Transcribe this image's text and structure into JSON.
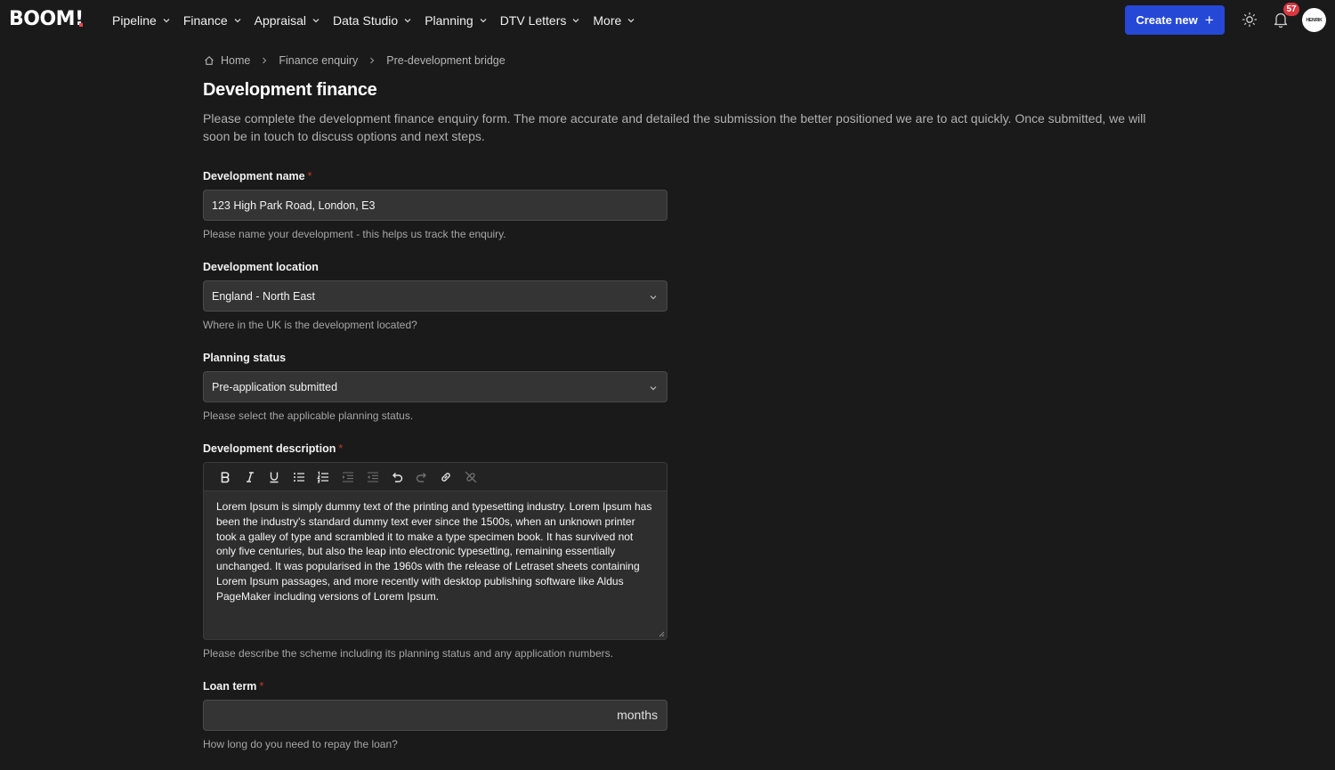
{
  "app": {
    "logo_text": "BOOM",
    "logo_mark": "!"
  },
  "nav": {
    "items": [
      {
        "label": "Pipeline"
      },
      {
        "label": "Finance"
      },
      {
        "label": "Appraisal"
      },
      {
        "label": "Data Studio"
      },
      {
        "label": "Planning"
      },
      {
        "label": "DTV Letters"
      },
      {
        "label": "More"
      }
    ],
    "create_label": "Create new",
    "create_icon": "plus-icon",
    "notification_count": "57",
    "avatar_text": "HENRIK"
  },
  "breadcrumb": {
    "items": [
      "Home",
      "Finance enquiry",
      "Pre-development bridge"
    ]
  },
  "page": {
    "title": "Development finance",
    "intro": "Please complete the development finance enquiry form. The more accurate and detailed the submission the better positioned we are to act quickly. Once submitted, we will soon be in touch to discuss options and next steps."
  },
  "form": {
    "dev_name": {
      "label": "Development name",
      "required_mark": "*",
      "value": "123 High Park Road, London, E3",
      "help": "Please name your development - this helps us track the enquiry."
    },
    "dev_location": {
      "label": "Development location",
      "value": "England - North East",
      "help": "Where in the UK is the development located?"
    },
    "planning_status": {
      "label": "Planning status",
      "value": "Pre-application submitted",
      "help": "Please select the applicable planning status."
    },
    "dev_description": {
      "label": "Development description",
      "required_mark": "*",
      "value": "Lorem Ipsum is simply dummy text of the printing and typesetting industry. Lorem Ipsum has been the industry's standard dummy text ever since the 1500s, when an unknown printer took a galley of type and scrambled it to make a type specimen book. It has survived not only five centuries, but also the leap into electronic typesetting, remaining essentially unchanged. It was popularised in the 1960s with the release of Letraset sheets containing Lorem Ipsum passages, and more recently with desktop publishing software like Aldus PageMaker including versions of Lorem Ipsum.",
      "help": "Please describe the scheme including its planning status and any application numbers."
    },
    "loan_term": {
      "label": "Loan term",
      "required_mark": "*",
      "value": "",
      "suffix": "months",
      "help": "How long do you need to repay the loan?"
    }
  },
  "colors": {
    "background": "#1a1a1a",
    "accent": "#2548d6",
    "required": "#c0392b",
    "badge": "#d9363e"
  }
}
